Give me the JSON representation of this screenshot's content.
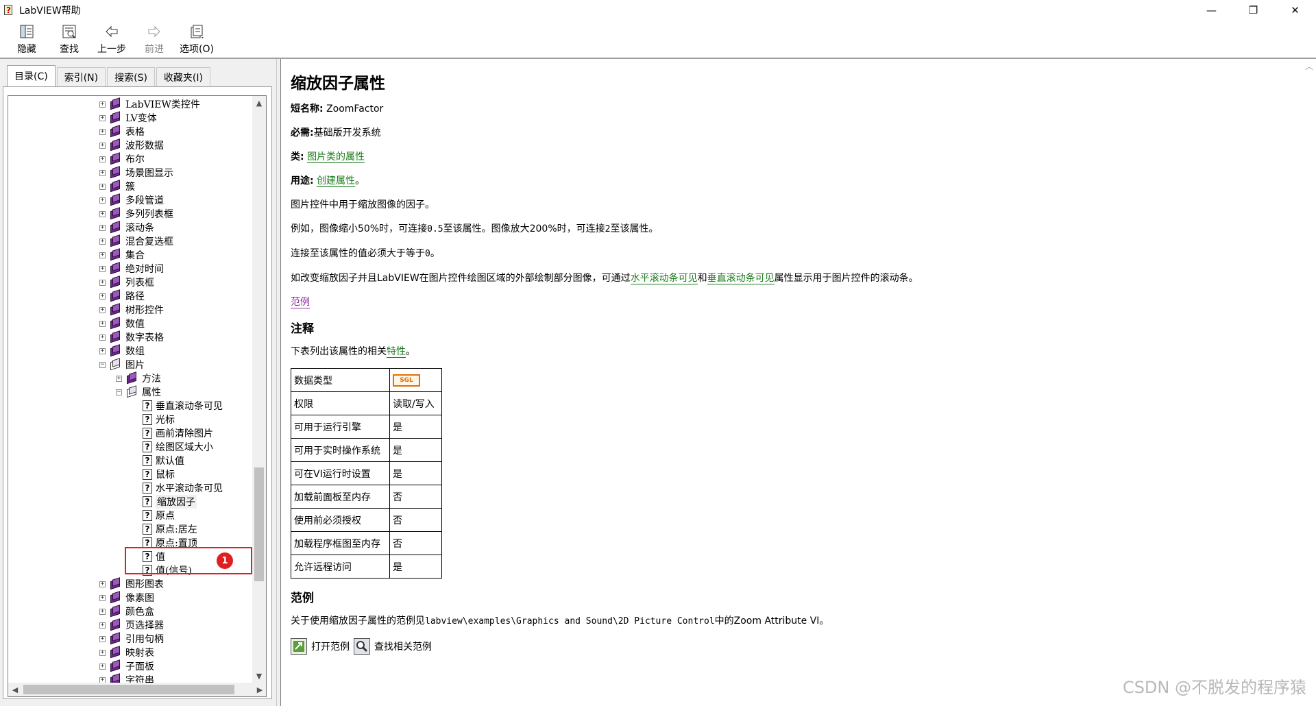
{
  "window": {
    "title": "LabVIEW帮助",
    "minimize": "—",
    "restore": "❐",
    "close": "✕"
  },
  "toolbar": {
    "hide": "隐藏",
    "find": "查找",
    "back": "上一步",
    "forward": "前进",
    "options": "选项(O)"
  },
  "tabs": {
    "contents": "目录(C)",
    "index": "索引(N)",
    "search": "搜索(S)",
    "favorites": "收藏夹(I)"
  },
  "tree": {
    "items": [
      {
        "label": "LabVIEW类控件",
        "type": "book",
        "level": 0,
        "expander": "+"
      },
      {
        "label": "LV变体",
        "type": "book",
        "level": 0,
        "expander": "+"
      },
      {
        "label": "表格",
        "type": "book",
        "level": 0,
        "expander": "+"
      },
      {
        "label": "波形数据",
        "type": "book",
        "level": 0,
        "expander": "+"
      },
      {
        "label": "布尔",
        "type": "book",
        "level": 0,
        "expander": "+"
      },
      {
        "label": "场景图显示",
        "type": "book",
        "level": 0,
        "expander": "+"
      },
      {
        "label": "簇",
        "type": "book",
        "level": 0,
        "expander": "+"
      },
      {
        "label": "多段管道",
        "type": "book",
        "level": 0,
        "expander": "+"
      },
      {
        "label": "多列列表框",
        "type": "book",
        "level": 0,
        "expander": "+"
      },
      {
        "label": "滚动条",
        "type": "book",
        "level": 0,
        "expander": "+"
      },
      {
        "label": "混合复选框",
        "type": "book",
        "level": 0,
        "expander": "+"
      },
      {
        "label": "集合",
        "type": "book",
        "level": 0,
        "expander": "+"
      },
      {
        "label": "绝对时间",
        "type": "book",
        "level": 0,
        "expander": "+"
      },
      {
        "label": "列表框",
        "type": "book",
        "level": 0,
        "expander": "+"
      },
      {
        "label": "路径",
        "type": "book",
        "level": 0,
        "expander": "+"
      },
      {
        "label": "树形控件",
        "type": "book",
        "level": 0,
        "expander": "+"
      },
      {
        "label": "数值",
        "type": "book",
        "level": 0,
        "expander": "+"
      },
      {
        "label": "数字表格",
        "type": "book",
        "level": 0,
        "expander": "+"
      },
      {
        "label": "数组",
        "type": "book",
        "level": 0,
        "expander": "+"
      },
      {
        "label": "图片",
        "type": "book-open",
        "level": 0,
        "expander": "−"
      },
      {
        "label": "方法",
        "type": "book",
        "level": 1,
        "expander": "+"
      },
      {
        "label": "属性",
        "type": "book-open",
        "level": 1,
        "expander": "−"
      },
      {
        "label": "垂直滚动条可见",
        "type": "page",
        "level": 2,
        "expander": ""
      },
      {
        "label": "光标",
        "type": "page",
        "level": 2,
        "expander": ""
      },
      {
        "label": "画前清除图片",
        "type": "page",
        "level": 2,
        "expander": ""
      },
      {
        "label": "绘图区域大小",
        "type": "page",
        "level": 2,
        "expander": ""
      },
      {
        "label": "默认值",
        "type": "page",
        "level": 2,
        "expander": ""
      },
      {
        "label": "鼠标",
        "type": "page",
        "level": 2,
        "expander": ""
      },
      {
        "label": "水平滚动条可见",
        "type": "page",
        "level": 2,
        "expander": ""
      },
      {
        "label": "缩放因子",
        "type": "page",
        "level": 2,
        "expander": "",
        "selected": true
      },
      {
        "label": "原点",
        "type": "page",
        "level": 2,
        "expander": ""
      },
      {
        "label": "原点:居左",
        "type": "page",
        "level": 2,
        "expander": ""
      },
      {
        "label": "原点:置顶",
        "type": "page",
        "level": 2,
        "expander": ""
      },
      {
        "label": "值",
        "type": "page",
        "level": 2,
        "expander": ""
      },
      {
        "label": "值(信号)",
        "type": "page",
        "level": 2,
        "expander": ""
      },
      {
        "label": "图形图表",
        "type": "book",
        "level": 0,
        "expander": "+"
      },
      {
        "label": "像素图",
        "type": "book",
        "level": 0,
        "expander": "+"
      },
      {
        "label": "颜色盒",
        "type": "book",
        "level": 0,
        "expander": "+"
      },
      {
        "label": "页选择器",
        "type": "book",
        "level": 0,
        "expander": "+"
      },
      {
        "label": "引用句柄",
        "type": "book",
        "level": 0,
        "expander": "+"
      },
      {
        "label": "映射表",
        "type": "book",
        "level": 0,
        "expander": "+"
      },
      {
        "label": "子面板",
        "type": "book",
        "level": 0,
        "expander": "+"
      },
      {
        "label": "字符串",
        "type": "book",
        "level": 0,
        "expander": "+"
      }
    ],
    "badge": "1"
  },
  "content": {
    "title": "缩放因子属性",
    "short_name_label": "短名称:",
    "short_name_value": "ZoomFactor",
    "requires_label": "必需:",
    "requires_value": "基础版开发系统",
    "class_label": "类:",
    "class_link": "图片类的属性",
    "usage_label": "用途:",
    "usage_link": "创建属性",
    "usage_suffix": "。",
    "desc1": "图片控件中用于缩放图像的因子。",
    "desc2_a": "例如，图像缩小50%时，可连接",
    "desc2_b": "0.5",
    "desc2_c": "至该属性。图像放大200%时，可连接",
    "desc2_d": "2",
    "desc2_e": "至该属性。",
    "desc3_a": "连接至该属性的值必须大于等于",
    "desc3_b": "0",
    "desc3_c": "。",
    "desc4_a": "如改变缩放因子并且LabVIEW在图片控件绘图区域的外部绘制部分图像，可通过",
    "desc4_link1": "水平滚动条可见",
    "desc4_b": "和",
    "desc4_link2": "垂直滚动条可见",
    "desc4_c": "属性显示用于图片控件的滚动条。",
    "examples_link": "范例",
    "notes_heading": "注释",
    "notes_intro_a": "下表列出该属性的相关",
    "notes_intro_link": "特性",
    "notes_intro_b": "。",
    "table": [
      {
        "key": "数据类型",
        "value": "",
        "sgl": "SGL"
      },
      {
        "key": "权限",
        "value": "读取/写入"
      },
      {
        "key": "可用于运行引擎",
        "value": "是"
      },
      {
        "key": "可用于实时操作系统",
        "value": "是"
      },
      {
        "key": "可在VI运行时设置",
        "value": "是"
      },
      {
        "key": "加载前面板至内存",
        "value": "否"
      },
      {
        "key": "使用前必须授权",
        "value": "否"
      },
      {
        "key": "加载程序框图至内存",
        "value": "否"
      },
      {
        "key": "允许远程访问",
        "value": "是"
      }
    ],
    "examples_heading": "范例",
    "examples_text_a": "关于使用缩放因子属性的范例见",
    "examples_path": "labview\\examples\\Graphics and Sound\\2D Picture Control",
    "examples_text_b": "中的Zoom Attribute VI。",
    "open_example": "打开范例",
    "find_related": "查找相关范例"
  },
  "watermark": "CSDN @不脱发的程序猿"
}
